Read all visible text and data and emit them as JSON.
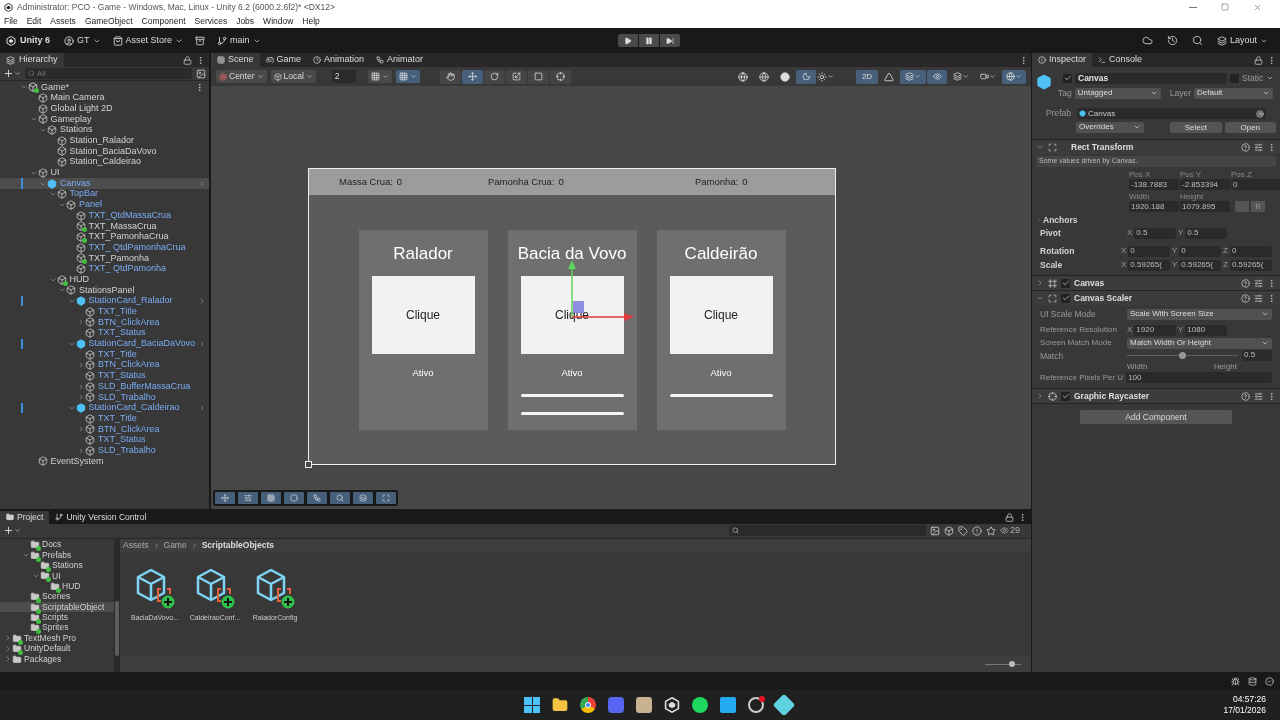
{
  "title_bar": {
    "title": "Administrator: PCO - Game - Windows, Mac, Linux - Unity 6.2 (6000.2.6f2)* <DX12>"
  },
  "menu": [
    "File",
    "Edit",
    "Assets",
    "GameObject",
    "Component",
    "Services",
    "Jobs",
    "Window",
    "Help"
  ],
  "toolbar": {
    "account": "Unity 6",
    "user": "GT",
    "store": "Asset Store",
    "branch": "main",
    "layout": "Layout"
  },
  "hierarchy": {
    "title": "Hierarchy",
    "search_placeholder": "All",
    "tree": [
      {
        "name": "Game*",
        "kind": "scene",
        "expanded": true,
        "selected": false,
        "children": [
          {
            "name": "Main Camera",
            "kind": "object",
            "selected": false
          },
          {
            "name": "Global Light 2D",
            "kind": "object",
            "selected": false
          },
          {
            "name": "Gameplay",
            "kind": "object",
            "expanded": true,
            "selected": false,
            "children": [
              {
                "name": "Stations",
                "kind": "object",
                "expanded": true,
                "selected": false,
                "children": [
                  {
                    "name": "Station_Ralador",
                    "kind": "object",
                    "selected": false
                  },
                  {
                    "name": "Station_BaciaDaVovo",
                    "kind": "object",
                    "selected": false
                  },
                  {
                    "name": "Station_Caldeirao",
                    "kind": "object",
                    "selected": false
                  }
                ]
              }
            ]
          },
          {
            "name": "UI",
            "kind": "object",
            "expanded": true,
            "selected": false,
            "children": [
              {
                "name": "Canvas",
                "kind": "prefab_root",
                "expanded": true,
                "selected": true,
                "children": [
                  {
                    "name": "TopBar",
                    "kind": "prefab",
                    "expanded": true,
                    "selected": false,
                    "children": [
                      {
                        "name": "Panel",
                        "kind": "prefab",
                        "expanded": true,
                        "selected": false,
                        "children": [
                          {
                            "name": "TXT_QtdMassaCrua",
                            "kind": "prefab",
                            "selected": false
                          },
                          {
                            "name": "TXT_MassaCrua",
                            "kind": "added",
                            "selected": false
                          },
                          {
                            "name": "TXT_PamonhaCrua",
                            "kind": "added",
                            "selected": false
                          },
                          {
                            "name": "TXT_ QtdPamonhaCrua",
                            "kind": "prefab",
                            "selected": false
                          },
                          {
                            "name": "TXT_Pamonha",
                            "kind": "added",
                            "selected": false
                          },
                          {
                            "name": "TXT_ QtdPamonha",
                            "kind": "prefab",
                            "selected": false
                          }
                        ]
                      }
                    ]
                  },
                  {
                    "name": "HUD",
                    "kind": "added",
                    "expanded": true,
                    "selected": false,
                    "children": [
                      {
                        "name": "StationsPanel",
                        "kind": "object",
                        "expanded": true,
                        "selected": false,
                        "children": [
                          {
                            "name": "StationCard_Ralador",
                            "kind": "prefab_root",
                            "expanded": true,
                            "selected": false,
                            "children": [
                              {
                                "name": "TXT_Title",
                                "kind": "prefab",
                                "selected": false
                              },
                              {
                                "name": "BTN_ClickArea",
                                "kind": "prefab",
                                "expanded": false,
                                "selected": false
                              },
                              {
                                "name": "TXT_Status",
                                "kind": "prefab",
                                "selected": false
                              }
                            ]
                          },
                          {
                            "name": "StationCard_BaciaDaVovo",
                            "kind": "prefab_root",
                            "expanded": true,
                            "selected": false,
                            "children": [
                              {
                                "name": "TXT_Title",
                                "kind": "prefab",
                                "selected": false
                              },
                              {
                                "name": "BTN_ClickArea",
                                "kind": "prefab",
                                "expanded": false,
                                "selected": false
                              },
                              {
                                "name": "TXT_Status",
                                "kind": "prefab",
                                "selected": false
                              },
                              {
                                "name": "SLD_BufferMassaCrua",
                                "kind": "prefab",
                                "expanded": false,
                                "selected": false
                              },
                              {
                                "name": "SLD_Trabalho",
                                "kind": "prefab",
                                "expanded": false,
                                "selected": false
                              }
                            ]
                          },
                          {
                            "name": "StationCard_Caldeirao",
                            "kind": "prefab_root",
                            "expanded": true,
                            "selected": false,
                            "children": [
                              {
                                "name": "TXT_Title",
                                "kind": "prefab",
                                "selected": false
                              },
                              {
                                "name": "BTN_ClickArea",
                                "kind": "prefab",
                                "expanded": false,
                                "selected": false
                              },
                              {
                                "name": "TXT_Status",
                                "kind": "prefab",
                                "selected": false
                              },
                              {
                                "name": "SLD_Trabalho",
                                "kind": "prefab",
                                "expanded": false,
                                "selected": false
                              }
                            ]
                          }
                        ]
                      }
                    ]
                  }
                ]
              }
            ]
          },
          {
            "name": "EventSystem",
            "kind": "object",
            "selected": false
          }
        ]
      }
    ]
  },
  "scene": {
    "tabs": [
      {
        "label": "Scene",
        "kind": "scene",
        "selected": true
      },
      {
        "label": "Game",
        "kind": "game",
        "selected": false
      },
      {
        "label": "Animation",
        "kind": "animation",
        "selected": false
      },
      {
        "label": "Animator",
        "kind": "animator",
        "selected": false
      }
    ],
    "pivot": "Center",
    "space": "Local",
    "grid_size": "2",
    "tools": [
      {
        "kind": "hand",
        "selected": false
      },
      {
        "kind": "move",
        "selected": true
      },
      {
        "kind": "rotate",
        "selected": false
      },
      {
        "kind": "scale",
        "selected": false
      },
      {
        "kind": "rect",
        "selected": false
      },
      {
        "kind": "transform",
        "selected": false
      }
    ],
    "mode_2d": {
      "label": "2D",
      "on": true
    },
    "move_handle": true,
    "topbar": [
      {
        "label": "Massa Crua:",
        "value": "0"
      },
      {
        "label": "Pamonha Crua:",
        "value": "0"
      },
      {
        "label": "Pamonha:",
        "value": "0"
      }
    ],
    "cards": [
      {
        "title": "Ralador",
        "button": "Clique",
        "status": "Ativo"
      },
      {
        "title": "Bacia da Vovo",
        "button": "Clique",
        "status": "Ativo",
        "sliders": [
          {
            "level": 1
          },
          {
            "level": 1
          }
        ]
      },
      {
        "title": "Caldeirão",
        "button": "Clique",
        "status": "Ativo",
        "sliders": [
          {
            "level": 1
          }
        ]
      }
    ]
  },
  "inspector": {
    "tabs": [
      {
        "label": "Inspector",
        "selected": true
      },
      {
        "label": "Console",
        "selected": false
      }
    ],
    "object": {
      "active": true,
      "name": "Canvas",
      "static_label": "Static",
      "static": false,
      "tag_label": "Tag",
      "tag": "Untagged",
      "layer_label": "Layer",
      "layer": "Default",
      "prefab_label": "Prefab",
      "prefab": "Canvas",
      "overrides": "Overrides",
      "buttons": [
        "Select",
        "Open"
      ]
    },
    "components": [
      {
        "kind": "rect_transform",
        "name": "Rect Transform",
        "expanded": true,
        "note": "Some values driven by Canvas.",
        "fields": [
          {
            "label": "Pos X",
            "value": "-138.7883"
          },
          {
            "label": "Pos Y",
            "value": "-2.853394"
          },
          {
            "label": "Pos Z",
            "value": "0"
          },
          {
            "label": "Width",
            "value": "1920.188"
          },
          {
            "label": "Height",
            "value": "1079.895"
          }
        ],
        "reset": "R",
        "anchors": "Anchors",
        "vectors": [
          {
            "label": "Pivot",
            "axes": [
              {
                "axis": "X",
                "value": "0.5"
              },
              {
                "axis": "Y",
                "value": "0.5"
              }
            ]
          },
          {
            "label": "Rotation",
            "axes": [
              {
                "axis": "X",
                "value": "0"
              },
              {
                "axis": "Y",
                "value": "0"
              },
              {
                "axis": "Z",
                "value": "0"
              }
            ]
          },
          {
            "label": "Scale",
            "axes": [
              {
                "axis": "X",
                "value": "0.59265("
              },
              {
                "axis": "Y",
                "value": "0.59265("
              },
              {
                "axis": "Z",
                "value": "0.59265("
              }
            ]
          }
        ]
      },
      {
        "kind": "canvas",
        "name": "Canvas",
        "expanded": false,
        "enabled": true
      },
      {
        "kind": "canvas_scaler",
        "name": "Canvas Scaler",
        "expanded": true,
        "enabled": true,
        "scale_mode": {
          "label": "UI Scale Mode",
          "value": "Scale With Screen Size"
        },
        "resolution": {
          "label": "Reference Resolution",
          "axes": [
            {
              "axis": "X",
              "value": "1920"
            },
            {
              "axis": "Y",
              "value": "1080"
            }
          ]
        },
        "match_mode": {
          "label": "Screen Match Mode",
          "value": "Match Width Or Height"
        },
        "match": {
          "label": "Match",
          "level": 0.5,
          "value": "0.5",
          "min_label": "Width",
          "max_label": "Height"
        },
        "pixels": {
          "label": "Reference Pixels Per U",
          "value": "100"
        }
      },
      {
        "kind": "raycaster",
        "name": "Graphic Raycaster",
        "expanded": false,
        "enabled": true
      }
    ],
    "add_component": "Add Component"
  },
  "project": {
    "tabs": [
      {
        "label": "Project",
        "selected": true
      },
      {
        "label": "Unity Version Control",
        "selected": false
      }
    ],
    "folders": [
      {
        "name": "Docs",
        "kind": "added",
        "selected": false
      },
      {
        "name": "Prefabs",
        "kind": "added",
        "expanded": true,
        "selected": false,
        "children": [
          {
            "name": "Stations",
            "kind": "added",
            "selected": false
          },
          {
            "name": "UI",
            "kind": "added",
            "expanded": true,
            "selected": false,
            "children": [
              {
                "name": "HUD",
                "kind": "added",
                "selected": false
              }
            ]
          }
        ]
      },
      {
        "name": "Scenes",
        "kind": "added",
        "selected": false
      },
      {
        "name": "ScriptableObject",
        "kind": "added",
        "selected": true
      },
      {
        "name": "Scripts",
        "kind": "added",
        "selected": false
      },
      {
        "name": "Sprites",
        "kind": "added",
        "selected": false
      },
      {
        "name": "TextMesh Pro",
        "kind": "added",
        "expanded": false,
        "selected": false,
        "root": true
      },
      {
        "name": "UnityDefault",
        "kind": "added",
        "expanded": false,
        "selected": false,
        "root": true
      },
      {
        "name": "Packages",
        "kind": "plain",
        "expanded": false,
        "selected": false,
        "root": true
      }
    ],
    "breadcrumb": [
      "Assets",
      "Game",
      "ScriptableObjects"
    ],
    "assets": [
      "BaciaDaVovo...",
      "CaldeiraoConf...",
      "RaladorConfig"
    ],
    "count": "29",
    "icon_size": {
      "level": 0.75
    }
  },
  "taskbar": {
    "time": "04:57:26",
    "date": "17/01/2026"
  }
}
